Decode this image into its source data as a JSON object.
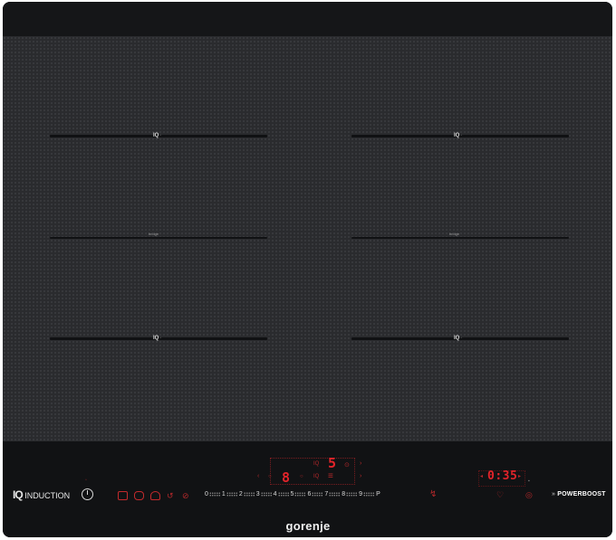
{
  "zones": {
    "top_left_label": "IQ",
    "top_right_label": "IQ",
    "bottom_left_label": "IQ",
    "bottom_right_label": "IQ",
    "bridge_left": "bridge",
    "bridge_right": "bridge"
  },
  "panel": {
    "iq_mark": "IQ",
    "induction_label": "INDUCTION",
    "power_scale": [
      "0",
      "1",
      "2",
      "3",
      "4",
      "5",
      "6",
      "7",
      "8",
      "9",
      "P"
    ],
    "zone_level": "8",
    "upper_level": "5",
    "timer_display": "0:35",
    "powerboost_label": "POWERBOOST"
  },
  "brand": "gorenje",
  "colors": {
    "glass": "#2a2b2e",
    "panel": "#111214",
    "display_red": "#e3242a",
    "text_white": "#dcdcdc"
  }
}
